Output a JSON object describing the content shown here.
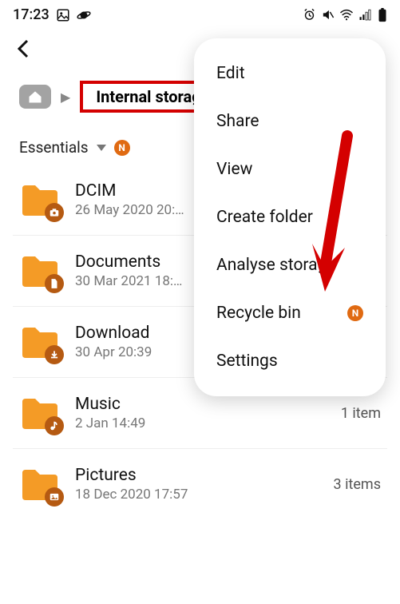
{
  "statusbar": {
    "time": "17:23"
  },
  "breadcrumb": {
    "current": "Internal storage"
  },
  "filter": {
    "label": "Essentials"
  },
  "items": [
    {
      "name": "DCIM",
      "date": "26 May 2020 20:…",
      "count": ""
    },
    {
      "name": "Documents",
      "date": "30 Mar 2021 18:…",
      "count": ""
    },
    {
      "name": "Download",
      "date": "30 Apr 20:39",
      "count": ""
    },
    {
      "name": "Music",
      "date": "2 Jan 14:49",
      "count": "1 item"
    },
    {
      "name": "Pictures",
      "date": "18 Dec 2020 17:57",
      "count": "3 items"
    }
  ],
  "menu": {
    "edit": "Edit",
    "share": "Share",
    "view": "View",
    "create_folder": "Create folder",
    "analyse_storage": "Analyse storage",
    "recycle_bin": "Recycle bin",
    "settings": "Settings"
  }
}
